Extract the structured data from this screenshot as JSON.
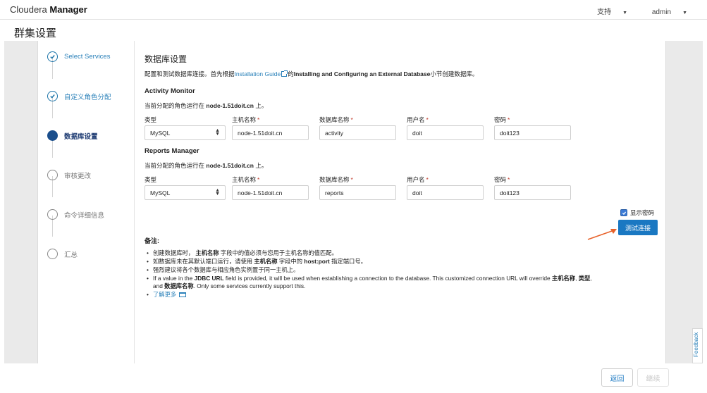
{
  "header": {
    "brand_light": "Cloudera",
    "brand_bold": "Manager",
    "support": "支持",
    "user": "admin"
  },
  "page_title": "群集设置",
  "steps": [
    {
      "label": "Select Services",
      "state": "done",
      "icon": "check-icon"
    },
    {
      "label": "自定义角色分配",
      "state": "done",
      "icon": "check-icon"
    },
    {
      "label": "数据库设置",
      "state": "active",
      "icon": "filled-circle-icon"
    },
    {
      "label": "审核更改",
      "state": "pending",
      "icon": "empty-circle-icon"
    },
    {
      "label": "命令详细信息",
      "state": "pending",
      "icon": "empty-circle-icon"
    },
    {
      "label": "汇总",
      "state": "pending",
      "icon": "empty-circle-icon"
    }
  ],
  "main": {
    "heading": "数据库设置",
    "desc_prefix": "配置和测试数据库连接。首先根据",
    "desc_link": "Installation Guide",
    "desc_mid": "的",
    "desc_bold": "Installing and Configuring an External Database",
    "desc_suffix": "小节创建数据库。"
  },
  "labels": {
    "type": "类型",
    "host": "主机名称",
    "dbname": "数据库名称",
    "user": "用户名",
    "password": "密码"
  },
  "sections": [
    {
      "title": "Activity Monitor",
      "sub_prefix": "当前分配的角色运行在",
      "sub_host": "node-1.51doit.cn",
      "sub_suffix": "上。",
      "type": "MySQL",
      "host": "node-1.51doit.cn",
      "dbname": "activity",
      "user": "doit",
      "password": "doit123"
    },
    {
      "title": "Reports Manager",
      "sub_prefix": "当前分配的角色运行在",
      "sub_host": "node-1.51doit.cn",
      "sub_suffix": "上。",
      "type": "MySQL",
      "host": "node-1.51doit.cn",
      "dbname": "reports",
      "user": "doit",
      "password": "doit123"
    }
  ],
  "show_password": {
    "label": "显示密码",
    "checked": true
  },
  "test_button": "测试连接",
  "notes": {
    "title": "备注",
    "n1_a": "创建数据库时，",
    "n1_b": "主机名称",
    "n1_c": "字段中的值必须与您用于主机名称的值匹配。",
    "n2_a": "如数据库未在其默认端口运行，请使用",
    "n2_b": "主机名称",
    "n2_c": "字段中的",
    "n2_d": "host:port",
    "n2_e": "指定端口号。",
    "n3": "强烈建议将各个数据库与相应角色实例置于同一主机上。",
    "n4_a": "If a value in the",
    "n4_b": "JDBC URL",
    "n4_c": "field is provided, it will be used when establishing a connection to the database. This customized connection URL will override",
    "n4_d": "主机名称",
    "n4_e": ",",
    "n4_f": "类型",
    "n4_g": ",",
    "n4_h": "and",
    "n4_i": "数据库名称",
    "n4_j": ". Only some services currently support this.",
    "n5": "了解更多"
  },
  "feedback": "Feedback",
  "footer": {
    "back": "返回",
    "next": "继续"
  },
  "colors": {
    "accent": "#1a78c2",
    "link": "#2980b9",
    "required": "#c0392b",
    "arrow": "#e8622a"
  }
}
